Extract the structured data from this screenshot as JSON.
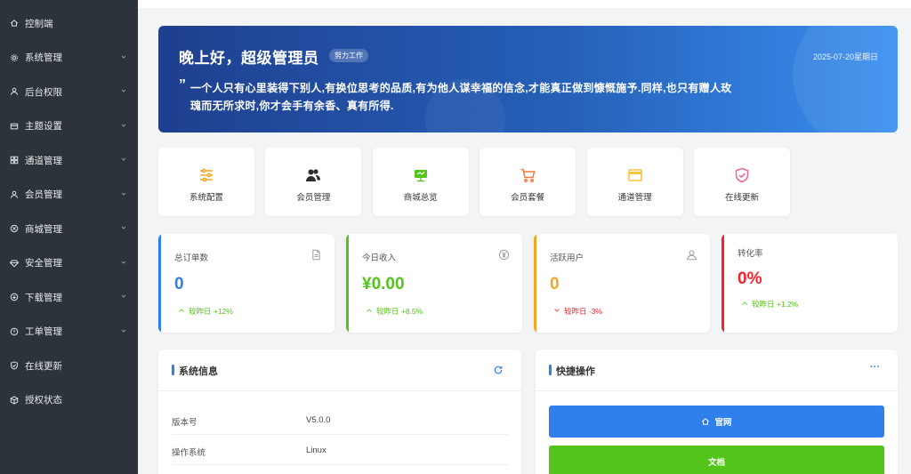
{
  "sidebar": {
    "items": [
      {
        "label": "控制端",
        "icon": "home-icon",
        "has_children": false
      },
      {
        "label": "系统管理",
        "icon": "gear-icon",
        "has_children": true
      },
      {
        "label": "后台权限",
        "icon": "user-icon",
        "has_children": true
      },
      {
        "label": "主题设置",
        "icon": "card-icon",
        "has_children": true
      },
      {
        "label": "通道管理",
        "icon": "grid-icon",
        "has_children": true
      },
      {
        "label": "会员管理",
        "icon": "user-icon",
        "has_children": true
      },
      {
        "label": "商城管理",
        "icon": "circle-x-icon",
        "has_children": true
      },
      {
        "label": "安全管理",
        "icon": "diamond-icon",
        "has_children": true
      },
      {
        "label": "下载管理",
        "icon": "download-icon",
        "has_children": true
      },
      {
        "label": "工单管理",
        "icon": "alert-icon",
        "has_children": true
      },
      {
        "label": "在线更新",
        "icon": "shield-check-icon",
        "has_children": false
      },
      {
        "label": "授权状态",
        "icon": "cube-icon",
        "has_children": false
      }
    ]
  },
  "banner": {
    "greeting": "晚上好，超级管理员",
    "tag": "努力工作",
    "date": "2025-07-20星期日",
    "quote_mark": "”",
    "quote": "一个人只有心里装得下别人,有换位思考的品质,有为他人谋幸福的信念,才能真正做到慷慨施予.同样,也只有赠人玫瑰而无所求时,你才会手有余香、真有所得."
  },
  "shortcuts": [
    {
      "label": "系统配置",
      "icon": "sliders-icon",
      "color": "#f5a623"
    },
    {
      "label": "会员管理",
      "icon": "users-icon",
      "color": "#2d2d2d"
    },
    {
      "label": "商城总览",
      "icon": "presentation-icon",
      "color": "#52c41a"
    },
    {
      "label": "会员套餐",
      "icon": "cart-icon",
      "color": "#f5793b"
    },
    {
      "label": "通道管理",
      "icon": "window-icon",
      "color": "#f5c342"
    },
    {
      "label": "在线更新",
      "icon": "shield-check-icon",
      "color": "#f06292"
    }
  ],
  "stats": [
    {
      "title": "总订单数",
      "value": "0",
      "trend": "较昨日 +12%",
      "direction": "up",
      "accent": "#2f80ed",
      "value_color": "#2f80ed",
      "trend_color": "#52c41a",
      "icon": "document-icon"
    },
    {
      "title": "今日收入",
      "value": "¥0.00",
      "trend": "较昨日 +8.5%",
      "direction": "up",
      "accent": "#52c41a",
      "value_color": "#52c41a",
      "trend_color": "#52c41a",
      "icon": "yen-icon"
    },
    {
      "title": "活跃用户",
      "value": "0",
      "trend": "较昨日 -3%",
      "direction": "down",
      "accent": "#f5a623",
      "value_color": "#f5a623",
      "trend_color": "#f5222d",
      "icon": "user-outline-icon"
    },
    {
      "title": "转化率",
      "value": "0%",
      "trend": "较昨日 +1.2%",
      "direction": "up",
      "accent": "#f5222d",
      "value_color": "#f5222d",
      "trend_color": "#52c41a",
      "icon": ""
    }
  ],
  "system_info": {
    "title": "系统信息",
    "rows": [
      {
        "key": "版本号",
        "value": "V5.0.0"
      },
      {
        "key": "操作系统",
        "value": "Linux"
      }
    ]
  },
  "quick_actions": {
    "title": "快捷操作",
    "more": "···",
    "buttons": [
      {
        "label": "官网",
        "icon": "home-icon",
        "color": "#2f80ed"
      },
      {
        "label": "文档",
        "icon": "",
        "color": "#52c41a"
      }
    ]
  }
}
